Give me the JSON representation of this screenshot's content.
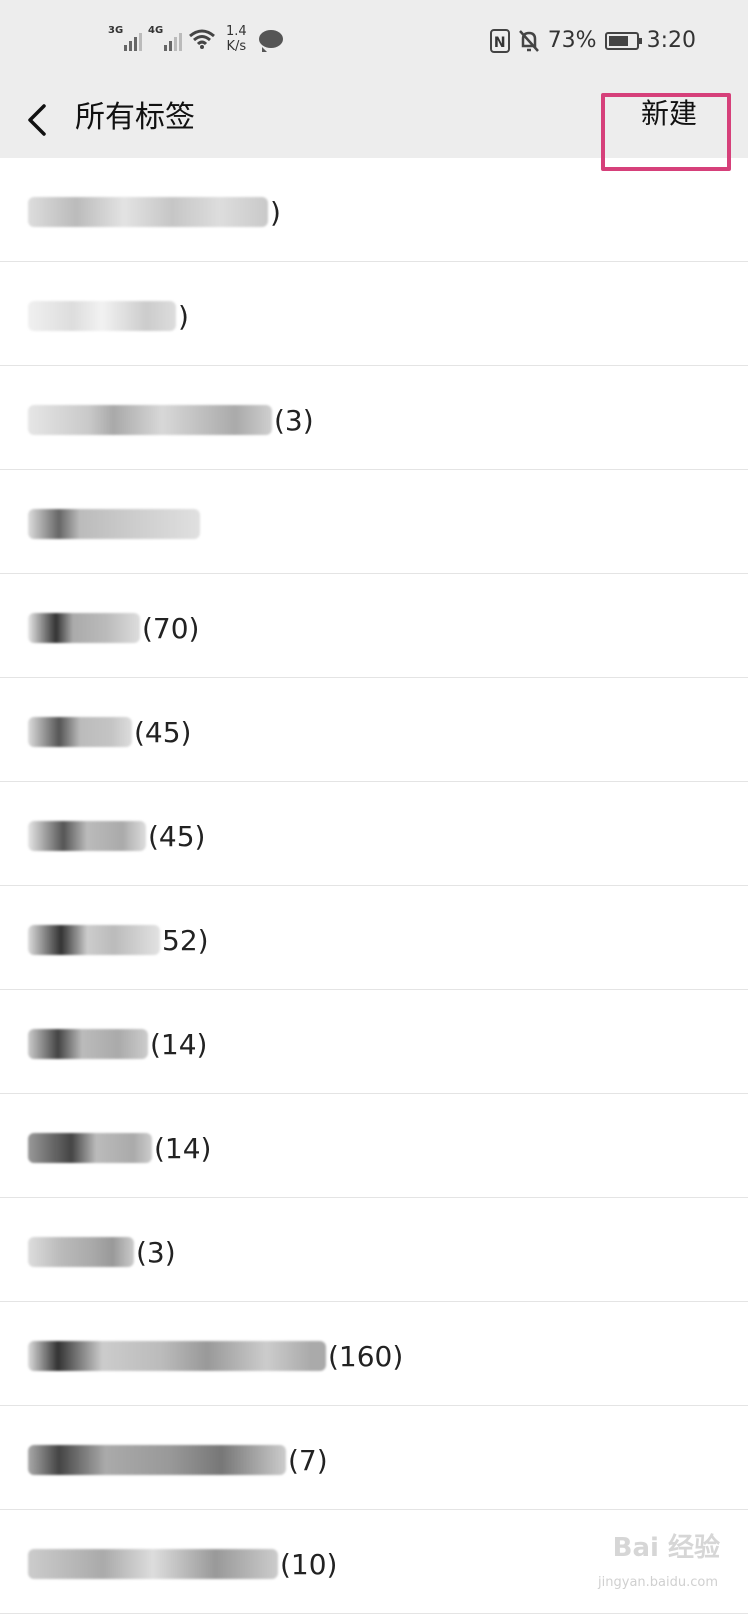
{
  "status_bar": {
    "sim1": "3G",
    "sim2": "4G",
    "speed_value": "1.4",
    "speed_unit": "K/s",
    "battery_percent": "73%",
    "battery_level": 0.73,
    "time": "3:20"
  },
  "header": {
    "title": "所有标签",
    "new_label": "新建"
  },
  "tags": [
    {
      "count": ")"
    },
    {
      "count": ")"
    },
    {
      "count": "(3)"
    },
    {
      "count": ""
    },
    {
      "count": "(70)"
    },
    {
      "count": "(45)"
    },
    {
      "count": "(45)"
    },
    {
      "count": "52)"
    },
    {
      "count": "(14)"
    },
    {
      "count": "(14)"
    },
    {
      "count": "(3)"
    },
    {
      "count": "(160)"
    },
    {
      "count": "(7)"
    },
    {
      "count": "(10)"
    }
  ],
  "watermark": {
    "text": "Bai 经验",
    "url": "jingyan.baidu.com"
  }
}
